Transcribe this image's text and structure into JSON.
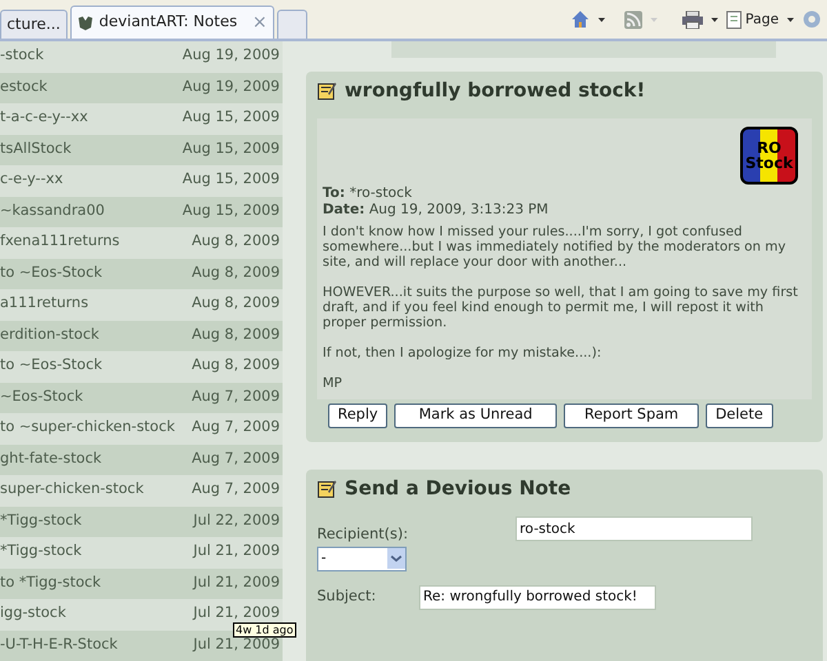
{
  "browser": {
    "tabs": [
      {
        "label": "cture...",
        "selected": false
      },
      {
        "label": "deviantART: Notes",
        "selected": true,
        "close": "×"
      },
      {
        "selected": false
      }
    ],
    "toolbar": {
      "page_label": "Page"
    }
  },
  "notes_list": [
    {
      "sender": "-stock",
      "date": "Aug 19, 2009"
    },
    {
      "sender": "estock",
      "date": "Aug 19, 2009"
    },
    {
      "sender": "t-a-c-e-y--xx",
      "date": "Aug 15, 2009"
    },
    {
      "sender": "tsAllStock",
      "date": "Aug 15, 2009"
    },
    {
      "sender": "c-e-y--xx",
      "date": "Aug 15, 2009"
    },
    {
      "sender": "~kassandra00",
      "date": "Aug 15, 2009"
    },
    {
      "sender": "fxena111returns",
      "date": "Aug 8, 2009"
    },
    {
      "sender": "to ~Eos-Stock",
      "date": "Aug 8, 2009"
    },
    {
      "sender": "a111returns",
      "date": "Aug 8, 2009"
    },
    {
      "sender": "erdition-stock",
      "date": "Aug 8, 2009"
    },
    {
      "sender": "to ~Eos-Stock",
      "date": "Aug 8, 2009"
    },
    {
      "sender": "~Eos-Stock",
      "date": "Aug 7, 2009"
    },
    {
      "sender": "to ~super-chicken-stock",
      "date": "Aug 7, 2009"
    },
    {
      "sender": "ght-fate-stock",
      "date": "Aug 7, 2009"
    },
    {
      "sender": "super-chicken-stock",
      "date": "Aug 7, 2009"
    },
    {
      "sender": "*Tigg-stock",
      "date": "Jul 22, 2009"
    },
    {
      "sender": "*Tigg-stock",
      "date": "Jul 21, 2009"
    },
    {
      "sender": "to *Tigg-stock",
      "date": "Jul 21, 2009"
    },
    {
      "sender": "igg-stock",
      "date": "Jul 21, 2009"
    },
    {
      "sender": "-U-T-H-E-R-Stock",
      "date": "Jul 21, 2009"
    }
  ],
  "tooltip": "4w 1d ago",
  "note": {
    "title": "wrongfully borrowed stock!",
    "avatar": {
      "line1": "RO",
      "line2": "Stock"
    },
    "to_label": "To:",
    "to": "*ro-stock",
    "date_label": "Date:",
    "date": "Aug 19, 2009, 3:13:23 PM",
    "paragraphs": [
      "I don't know how I missed your rules....I'm sorry, I got confused somewhere...but I was immediately notified by the moderators on my site, and will replace your door with another...",
      "HOWEVER...it suits the purpose so well, that I am going to save my first draft, and if you feel kind enough to permit me, I will repost it with proper permission.",
      "If not, then I apologize for my mistake....):",
      "MP"
    ],
    "buttons": [
      "Reply",
      "Mark as Unread",
      "Report Spam",
      "Delete"
    ]
  },
  "send_note": {
    "title": "Send a Devious Note",
    "recipient_label": "Recipient(s):",
    "recipient_select": "-",
    "recipient": "ro-stock",
    "subject_label": "Subject:",
    "subject": "Re: wrongfully borrowed stock!"
  }
}
